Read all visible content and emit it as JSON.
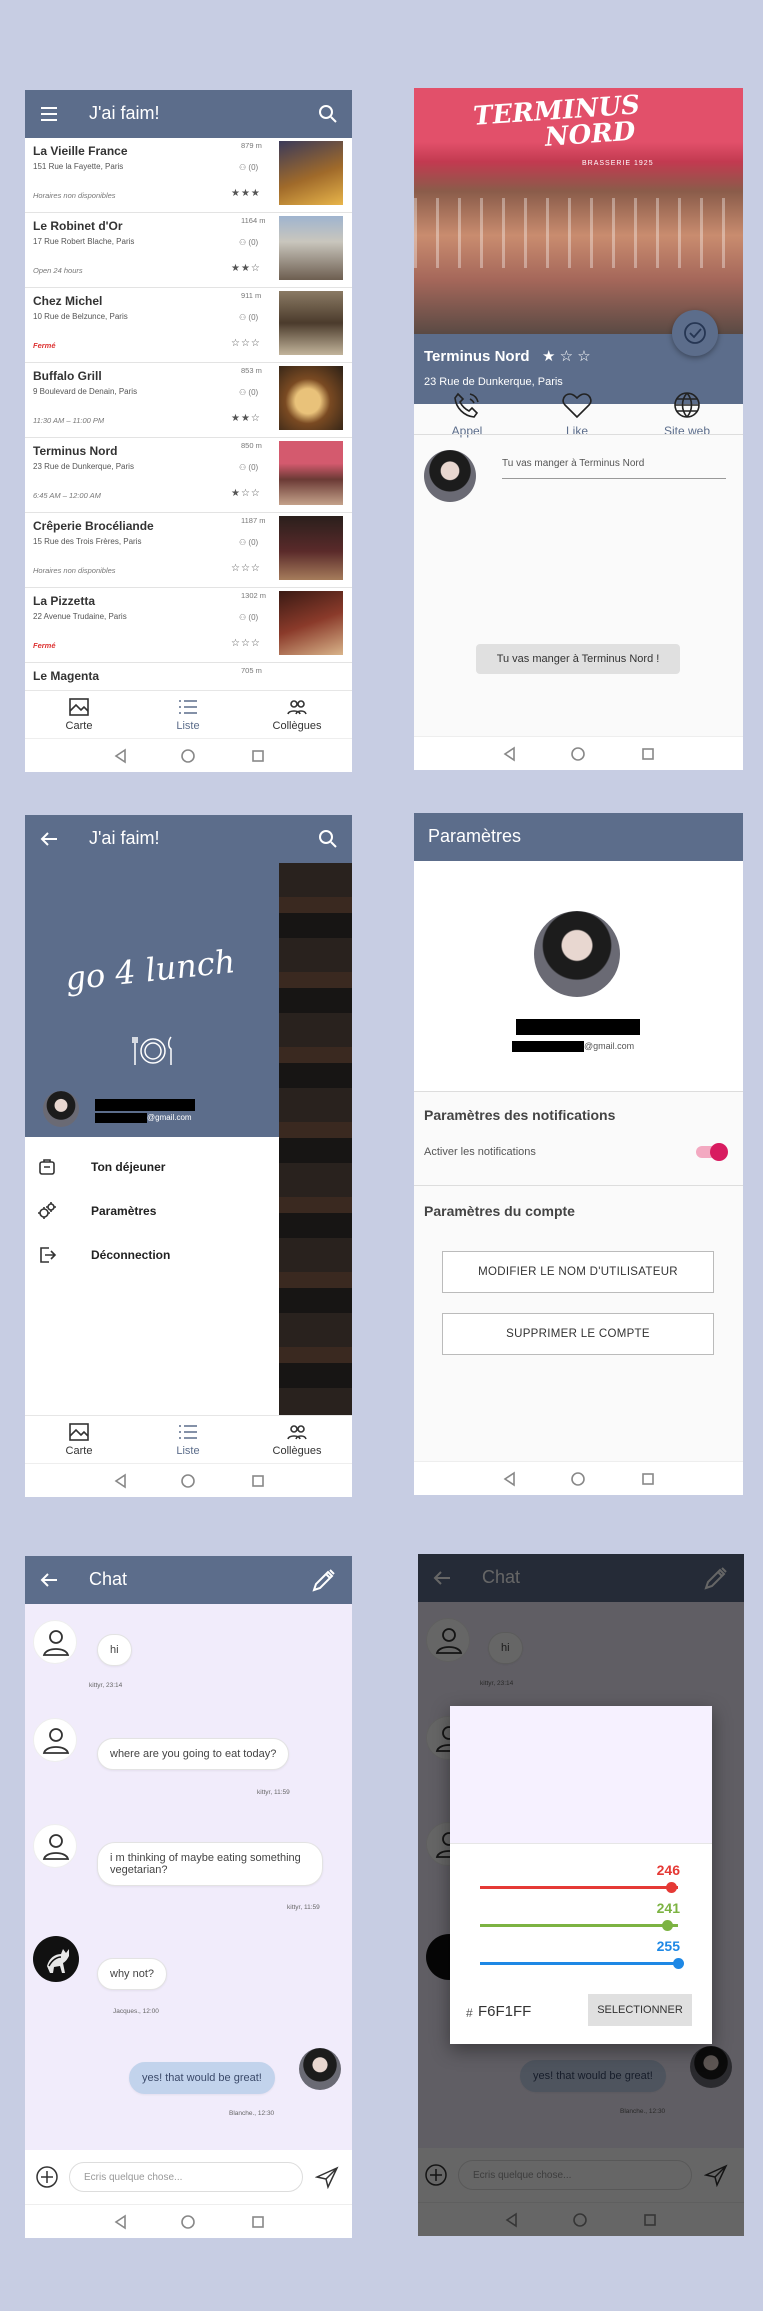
{
  "app": {
    "title": "J'ai faim!"
  },
  "restaurants": [
    {
      "name": "La Vieille France",
      "address": "151 Rue la Fayette, Paris",
      "hours": "Horaires non disponibles",
      "distance": "879 m",
      "workmates": "(0)",
      "stars": "★★★",
      "closed": false
    },
    {
      "name": "Le Robinet d'Or",
      "address": "17 Rue Robert Blache, Paris",
      "hours": "Open 24 hours",
      "distance": "1164 m",
      "workmates": "(0)",
      "stars": "★★☆",
      "closed": false
    },
    {
      "name": "Chez Michel",
      "address": "10 Rue de Belzunce, Paris",
      "hours": "Fermé",
      "distance": "911 m",
      "workmates": "(0)",
      "stars": "☆☆☆",
      "closed": true
    },
    {
      "name": "Buffalo Grill",
      "address": "9 Boulevard de Denain, Paris",
      "hours": "11:30 AM – 11:00 PM",
      "distance": "853 m",
      "workmates": "(0)",
      "stars": "★★☆",
      "closed": false
    },
    {
      "name": "Terminus Nord",
      "address": "23 Rue de Dunkerque, Paris",
      "hours": "6:45 AM – 12:00 AM",
      "distance": "850 m",
      "workmates": "(0)",
      "stars": "★☆☆",
      "closed": false
    },
    {
      "name": "Crêperie Brocéliande",
      "address": "15 Rue des Trois Frères, Paris",
      "hours": "Horaires non disponibles",
      "distance": "1187 m",
      "workmates": "(0)",
      "stars": "☆☆☆",
      "closed": false
    },
    {
      "name": "La Pizzetta",
      "address": "22 Avenue Trudaine, Paris",
      "hours": "Fermé",
      "distance": "1302 m",
      "workmates": "(0)",
      "stars": "☆☆☆",
      "closed": true
    },
    {
      "name": "Le Magenta",
      "address": "",
      "hours": "",
      "distance": "705 m",
      "workmates": "",
      "stars": "",
      "closed": false
    }
  ],
  "bottom_nav": {
    "map": "Carte",
    "list": "Liste",
    "workmates": "Collègues"
  },
  "detail": {
    "sign_line1": "TERMINUS",
    "sign_line2": "NORD",
    "sign_small": "BRASSERIE 1925",
    "name": "Terminus Nord",
    "stars": "★ ☆ ☆",
    "address": "23 Rue de Dunkerque, Paris",
    "call": "Appel",
    "like": "Like",
    "website": "Site web",
    "going_text": "Tu vas manger à  Terminus Nord",
    "toast": "Tu vas manger à Terminus Nord !"
  },
  "drawer": {
    "logo_line": "go 4 lunch",
    "email_suffix": "@gmail.com",
    "items": [
      "Ton déjeuner",
      "Paramètres",
      "Déconnection"
    ]
  },
  "settings": {
    "title": "Paramètres",
    "email_suffix": "@gmail.com",
    "notif_header": "Paramètres des notifications",
    "notif_label": "Activer les notifications",
    "notif_on": true,
    "account_header": "Paramètres du compte",
    "btn_rename": "MODIFIER LE NOM D'UTILISATEUR",
    "btn_delete": "SUPPRIMER LE COMPTE"
  },
  "chat": {
    "title": "Chat",
    "placeholder": "Ecris quelque chose...",
    "messages": [
      {
        "text": "hi",
        "caption": "kittyr, 23:14"
      },
      {
        "text": "where are you going to eat today?",
        "caption": "kittyr, 11:59"
      },
      {
        "text": "i m thinking of maybe eating something vegetarian?",
        "caption": "kittyr, 11:59"
      },
      {
        "text": "why not?",
        "caption": "Jacques., 12:00"
      },
      {
        "text": "yes! that would be great!",
        "caption": "Blanche., 12:30"
      }
    ]
  },
  "color_picker": {
    "r": "246",
    "g": "241",
    "b": "255",
    "r_frac": 0.965,
    "g_frac": 0.945,
    "b_frac": 1.0,
    "hash": "#",
    "hex": "F6F1FF",
    "select": "SELECTIONNER",
    "preview_color": "#F6F1FF"
  }
}
